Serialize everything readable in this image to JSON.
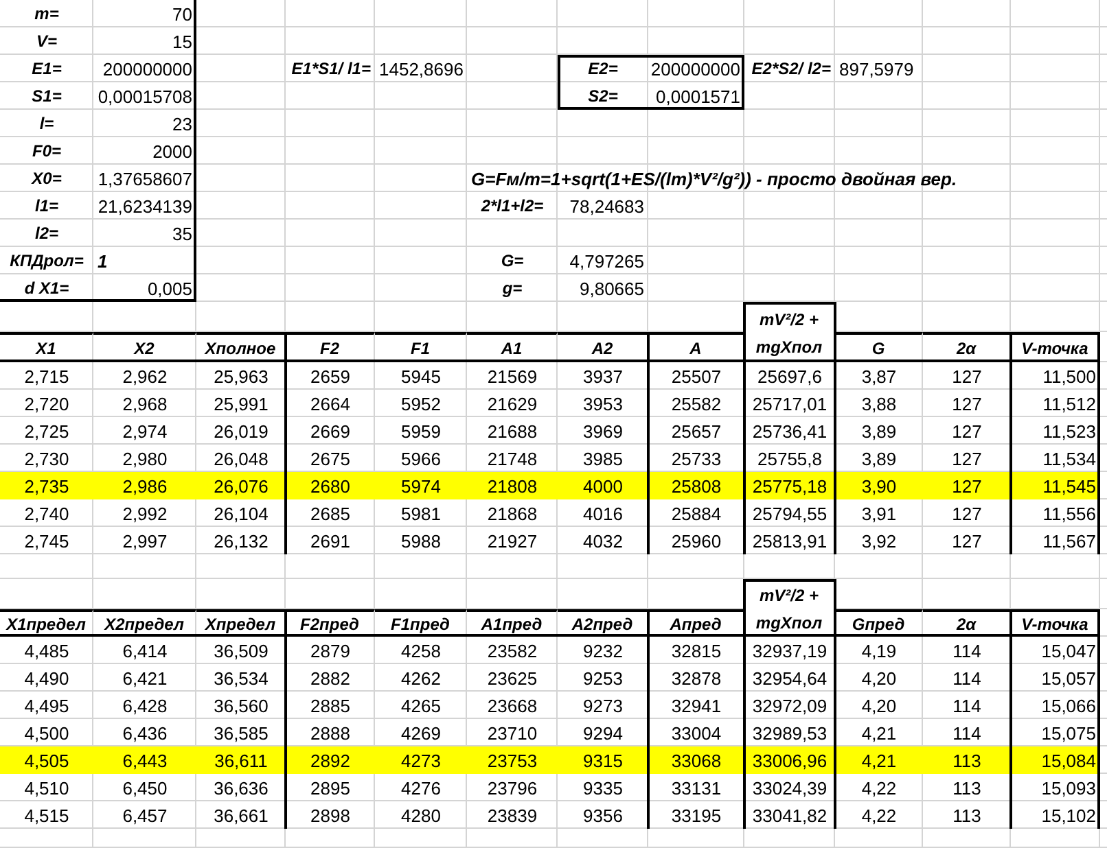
{
  "parameters": [
    {
      "label": "m=",
      "value": "70",
      "kind": "number"
    },
    {
      "label": "V=",
      "value": "15",
      "kind": "number"
    },
    {
      "label": "E1=",
      "value": "200000000",
      "kind": "number"
    },
    {
      "label": "S1=",
      "value": "0,00015708",
      "kind": "number"
    },
    {
      "label": "l=",
      "value": "23",
      "kind": "number"
    },
    {
      "label": "F0=",
      "value": "2000",
      "kind": "number"
    },
    {
      "label": "X0=",
      "value": "1,37658607",
      "kind": "number"
    },
    {
      "label": "l1=",
      "value": "21,6234139",
      "kind": "number"
    },
    {
      "label": "l2=",
      "value": "35",
      "kind": "number"
    },
    {
      "label": "КПДрол=",
      "value": "1",
      "kind": "text"
    },
    {
      "label": "d X1=",
      "value": "0,005",
      "kind": "number"
    }
  ],
  "rod1": {
    "label": "E1*S1/ l1=",
    "value": "1452,8696"
  },
  "rod2_inputs": [
    {
      "label": "E2=",
      "value": "200000000"
    },
    {
      "label": "S2=",
      "value": "0,0001571"
    }
  ],
  "rod2": {
    "label": "E2*S2/ l2=",
    "value": "897,5979"
  },
  "formula": "G=Fм/m=1+sqrt(1+ES/(lm)*V²/g²)) - просто двойная вер.",
  "results": [
    {
      "label": "2*l1+l2=",
      "value": "78,24683"
    },
    {
      "label": "G=",
      "value": "4,797265"
    },
    {
      "label": "g=",
      "value": "9,80665"
    }
  ],
  "tables": [
    {
      "columns": [
        {
          "label": "X1",
          "kind": "plain"
        },
        {
          "label": "X2",
          "kind": "plain"
        },
        {
          "label": "Xполное",
          "kind": "plain"
        },
        {
          "label": "F2",
          "kind": "plain"
        },
        {
          "label": "F1",
          "kind": "plain"
        },
        {
          "label": "A1",
          "kind": "plain"
        },
        {
          "label": "A2",
          "kind": "plain"
        },
        {
          "label": "A",
          "kind": "plain"
        },
        {
          "label": "mV²/2 +\nmgXпол",
          "kind": "stacked"
        },
        {
          "label": "G",
          "kind": "plain"
        },
        {
          "label": "2α",
          "kind": "plain"
        },
        {
          "label": "V-точка",
          "kind": "plain"
        }
      ],
      "rows": [
        {
          "cells": [
            "2,715",
            "2,962",
            "25,963",
            "2659",
            "5945",
            "21569",
            "3937",
            "25507",
            "25697,6",
            "3,87",
            "127",
            "11,500"
          ],
          "highlighted": false
        },
        {
          "cells": [
            "2,720",
            "2,968",
            "25,991",
            "2664",
            "5952",
            "21629",
            "3953",
            "25582",
            "25717,01",
            "3,88",
            "127",
            "11,512"
          ],
          "highlighted": false
        },
        {
          "cells": [
            "2,725",
            "2,974",
            "26,019",
            "2669",
            "5959",
            "21688",
            "3969",
            "25657",
            "25736,41",
            "3,89",
            "127",
            "11,523"
          ],
          "highlighted": false
        },
        {
          "cells": [
            "2,730",
            "2,980",
            "26,048",
            "2675",
            "5966",
            "21748",
            "3985",
            "25733",
            "25755,8",
            "3,89",
            "127",
            "11,534"
          ],
          "highlighted": false
        },
        {
          "cells": [
            "2,735",
            "2,986",
            "26,076",
            "2680",
            "5974",
            "21808",
            "4000",
            "25808",
            "25775,18",
            "3,90",
            "127",
            "11,545"
          ],
          "highlighted": true
        },
        {
          "cells": [
            "2,740",
            "2,992",
            "26,104",
            "2685",
            "5981",
            "21868",
            "4016",
            "25884",
            "25794,55",
            "3,91",
            "127",
            "11,556"
          ],
          "highlighted": false
        },
        {
          "cells": [
            "2,745",
            "2,997",
            "26,132",
            "2691",
            "5988",
            "21927",
            "4032",
            "25960",
            "25813,91",
            "3,92",
            "127",
            "11,567"
          ],
          "highlighted": false
        }
      ]
    },
    {
      "columns": [
        {
          "label": "X1предел",
          "kind": "plain"
        },
        {
          "label": "X2предел",
          "kind": "plain"
        },
        {
          "label": "Xпредел",
          "kind": "plain"
        },
        {
          "label": "F2пред",
          "kind": "plain"
        },
        {
          "label": "F1пред",
          "kind": "plain"
        },
        {
          "label": "A1пред",
          "kind": "plain"
        },
        {
          "label": "A2пред",
          "kind": "plain"
        },
        {
          "label": "Aпред",
          "kind": "plain"
        },
        {
          "label": "mV²/2 +\nmgXпол",
          "kind": "stacked"
        },
        {
          "label": "Gпред",
          "kind": "plain"
        },
        {
          "label": "2α",
          "kind": "plain"
        },
        {
          "label": "V-точка",
          "kind": "plain"
        }
      ],
      "rows": [
        {
          "cells": [
            "4,485",
            "6,414",
            "36,509",
            "2879",
            "4258",
            "23582",
            "9232",
            "32815",
            "32937,19",
            "4,19",
            "114",
            "15,047"
          ],
          "highlighted": false
        },
        {
          "cells": [
            "4,490",
            "6,421",
            "36,534",
            "2882",
            "4262",
            "23625",
            "9253",
            "32878",
            "32954,64",
            "4,20",
            "114",
            "15,057"
          ],
          "highlighted": false
        },
        {
          "cells": [
            "4,495",
            "6,428",
            "36,560",
            "2885",
            "4265",
            "23668",
            "9273",
            "32941",
            "32972,09",
            "4,20",
            "114",
            "15,066"
          ],
          "highlighted": false
        },
        {
          "cells": [
            "4,500",
            "6,436",
            "36,585",
            "2888",
            "4269",
            "23710",
            "9294",
            "33004",
            "32989,53",
            "4,21",
            "114",
            "15,075"
          ],
          "highlighted": false
        },
        {
          "cells": [
            "4,505",
            "6,443",
            "36,611",
            "2892",
            "4273",
            "23753",
            "9315",
            "33068",
            "33006,96",
            "4,21",
            "113",
            "15,084"
          ],
          "highlighted": true
        },
        {
          "cells": [
            "4,510",
            "6,450",
            "36,636",
            "2895",
            "4276",
            "23796",
            "9335",
            "33131",
            "33024,39",
            "4,22",
            "113",
            "15,093"
          ],
          "highlighted": false
        },
        {
          "cells": [
            "4,515",
            "6,457",
            "36,661",
            "2898",
            "4280",
            "23839",
            "9356",
            "33195",
            "33041,82",
            "4,22",
            "113",
            "15,102"
          ],
          "highlighted": false
        }
      ]
    }
  ]
}
